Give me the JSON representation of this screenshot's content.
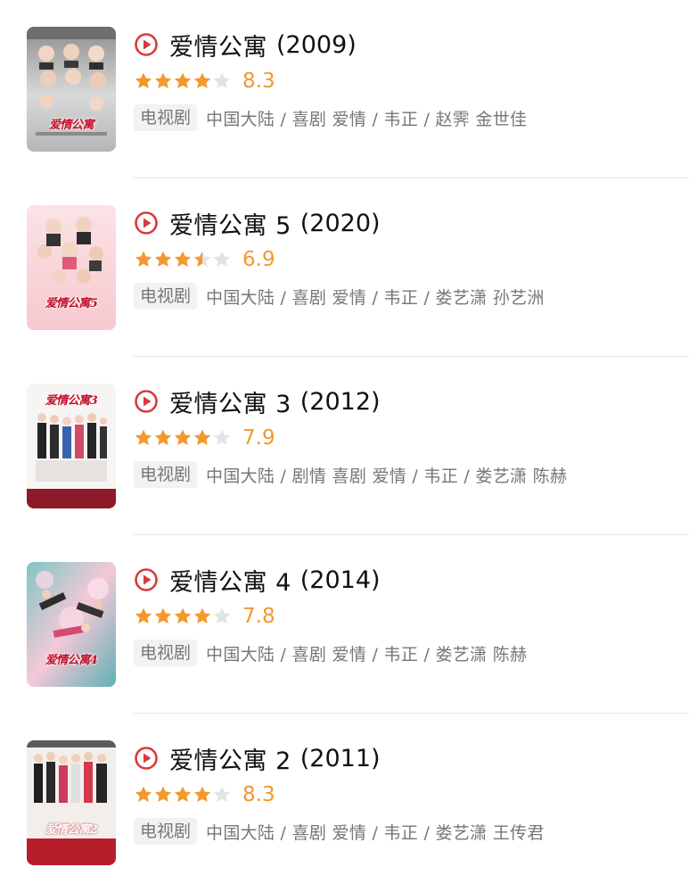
{
  "colors": {
    "accent_red": "#d83a3a",
    "star_filled": "#f2992e",
    "star_empty": "#e3e3e3",
    "score": "#f2992e",
    "meta_text": "#777777",
    "tag_bg": "#f2f2f2"
  },
  "icons": {
    "play": "play-circle-icon",
    "star": "star-icon"
  },
  "items": [
    {
      "title": "爱情公寓",
      "year": "(2009)",
      "rating": 4,
      "score": "8.3",
      "type": "电视剧",
      "meta": "中国大陆 / 喜剧 爱情 / 韦正 / 赵霁 金世佳",
      "poster_text": "爱情公寓"
    },
    {
      "title": "爱情公寓 5",
      "year": "(2020)",
      "rating": 3.5,
      "score": "6.9",
      "type": "电视剧",
      "meta": "中国大陆 / 喜剧 爱情 / 韦正 / 娄艺潇 孙艺洲",
      "poster_text": "爱情公寓5"
    },
    {
      "title": "爱情公寓 3",
      "year": "(2012)",
      "rating": 4,
      "score": "7.9",
      "type": "电视剧",
      "meta": "中国大陆 / 剧情 喜剧 爱情 / 韦正 / 娄艺潇 陈赫",
      "poster_text": "爱情公寓3"
    },
    {
      "title": "爱情公寓 4",
      "year": "(2014)",
      "rating": 4,
      "score": "7.8",
      "type": "电视剧",
      "meta": "中国大陆 / 喜剧 爱情 / 韦正 / 娄艺潇 陈赫",
      "poster_text": "爱情公寓4"
    },
    {
      "title": "爱情公寓 2",
      "year": "(2011)",
      "rating": 4,
      "score": "8.3",
      "type": "电视剧",
      "meta": "中国大陆 / 喜剧 爱情 / 韦正 / 娄艺潇 王传君",
      "poster_text": "爱情公寓2"
    }
  ]
}
